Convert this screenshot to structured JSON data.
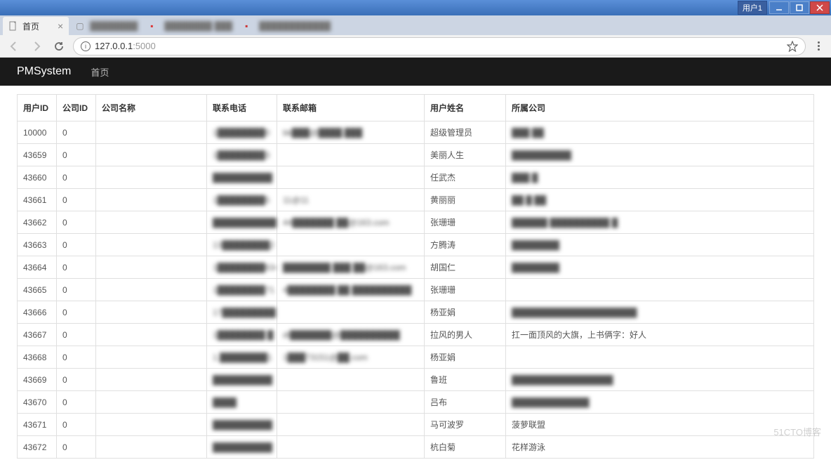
{
  "os": {
    "user_label": "用户1"
  },
  "browser": {
    "tabs": [
      {
        "title": "首页",
        "active": true
      },
      {
        "title": "████████",
        "active": false
      },
      {
        "title": "████████ ███",
        "active": false
      },
      {
        "title": "████████████",
        "active": false
      }
    ],
    "url_display": "127.0.0.1:5000",
    "url_host": "127.0.0.1",
    "url_port": ":5000"
  },
  "app": {
    "brand": "PMSystem",
    "nav_links": [
      "首页"
    ]
  },
  "table": {
    "headers": [
      "用户ID",
      "公司ID",
      "公司名称",
      "联系电话",
      "联系邮箱",
      "用户姓名",
      "所属公司"
    ],
    "rows": [
      {
        "uid": "10000",
        "cid": "0",
        "cname": "",
        "phone": "1████████0",
        "email": "bk███@████.███",
        "uname": "超级管理员",
        "comp": "███ ██"
      },
      {
        "uid": "43659",
        "cid": "0",
        "cname": "",
        "phone": "1████████3",
        "email": "",
        "uname": "美丽人生",
        "comp": "██████████"
      },
      {
        "uid": "43660",
        "cid": "0",
        "cname": "",
        "phone": "██████████",
        "email": "",
        "uname": "任武杰",
        "comp": "███ █"
      },
      {
        "uid": "43661",
        "cid": "0",
        "cname": "",
        "phone": "1████████5",
        "email": "11@11",
        "uname": "黄丽丽",
        "comp": "██ █ ██"
      },
      {
        "uid": "43662",
        "cid": "0",
        "cname": "",
        "phone": "███████████",
        "email": "44███████  ██@163.com",
        "uname": "张珊珊",
        "comp": "██████  ██████████ █"
      },
      {
        "uid": "43663",
        "cid": "0",
        "cname": "",
        "phone": "13████████2",
        "email": "",
        "uname": "方腾涛",
        "comp": "████████"
      },
      {
        "uid": "43664",
        "cid": "0",
        "cname": "",
        "phone": "1████████634",
        "email": "████████ ███ ██@163.com",
        "uname": "胡国仁",
        "comp": "████████"
      },
      {
        "uid": "43665",
        "cid": "0",
        "cname": "",
        "phone": "1████████71",
        "email": "4████████  ██ ██████████",
        "uname": "张珊珊",
        "comp": ""
      },
      {
        "uid": "43666",
        "cid": "0",
        "cname": "",
        "phone": "17█████████1",
        "email": "",
        "uname": "杨亚娟",
        "comp": "█████████████████████"
      },
      {
        "uid": "43667",
        "cid": "0",
        "cname": "",
        "phone": "1████████  █",
        "email": "dt███████@██████████",
        "uname": "拉风的男人",
        "comp": "扛一面顶风的大旗，上书俩字：好人"
      },
      {
        "uid": "43668",
        "cid": "0",
        "cname": "",
        "phone": "1.████████1",
        "email": "1███73151@██.com",
        "uname": "杨亚娟",
        "comp": ""
      },
      {
        "uid": "43669",
        "cid": "0",
        "cname": "",
        "phone": "██████████",
        "email": "",
        "uname": "鲁班",
        "comp": "█████████████████"
      },
      {
        "uid": "43670",
        "cid": "0",
        "cname": "",
        "phone": "   ████",
        "email": "",
        "uname": "吕布",
        "comp": "█████████████"
      },
      {
        "uid": "43671",
        "cid": "0",
        "cname": "",
        "phone": "██████████",
        "email": "",
        "uname": "马可波罗",
        "comp": "菠萝联盟"
      },
      {
        "uid": "43672",
        "cid": "0",
        "cname": "",
        "phone": "██████████",
        "email": "",
        "uname": "杭白菊",
        "comp": "花样游泳"
      }
    ]
  },
  "watermark": "51CTO博客"
}
